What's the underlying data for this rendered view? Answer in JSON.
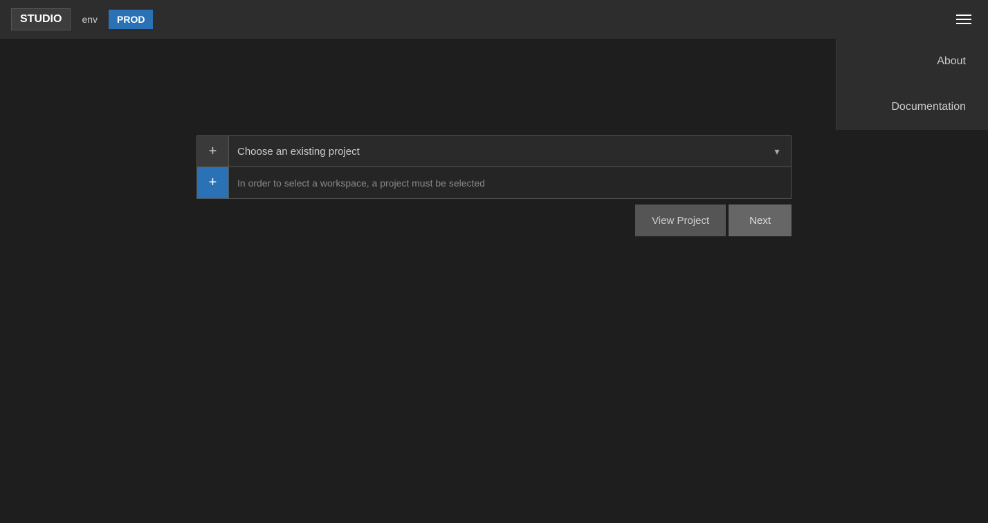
{
  "navbar": {
    "studio_label": "STUDIO",
    "env_label": "env",
    "prod_badge": "PROD",
    "hamburger_aria": "Open menu"
  },
  "dropdown_menu": {
    "items": [
      {
        "label": "About",
        "id": "about"
      },
      {
        "label": "Documentation",
        "id": "documentation"
      }
    ]
  },
  "project_selector": {
    "plus_btn_1_label": "+",
    "plus_btn_2_label": "+",
    "dropdown_placeholder": "Choose an existing project",
    "dropdown_arrow": "▾",
    "workspace_hint": "In order to select a workspace, a project must be selected"
  },
  "action_buttons": {
    "view_project_label": "View Project",
    "next_label": "Next"
  }
}
